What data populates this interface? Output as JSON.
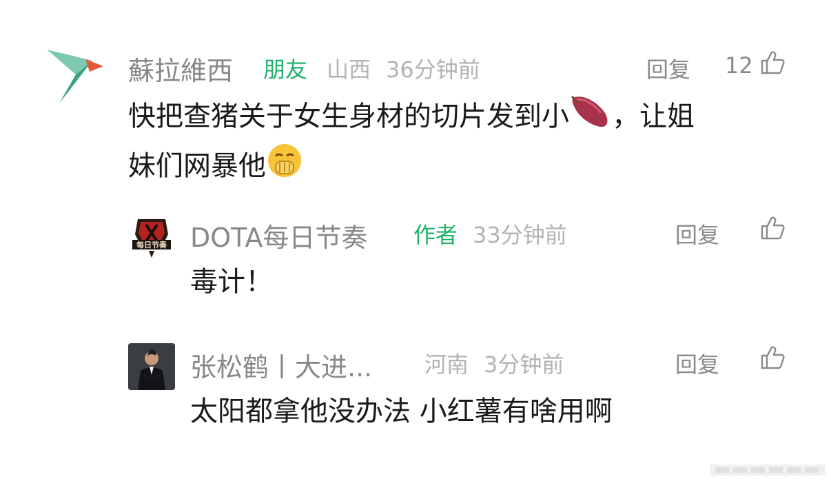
{
  "comments": [
    {
      "username": "蘇拉維西",
      "badge": "朋友",
      "location": "山西",
      "time": "36分钟前",
      "reply_label": "回复",
      "likes": "12",
      "content_line1_a": "快把查猪关于女生身材的切片发到小",
      "content_line1_b": "，让姐",
      "content_line2": "妹们网暴他",
      "inline_emoji_1": "sweet-potato-emoji",
      "inline_emoji_2": "fingers-together-smirk-emoji"
    }
  ],
  "replies": [
    {
      "username": "DOTA每日节奏",
      "badge": "作者",
      "time": "33分钟前",
      "reply_label": "回复",
      "content": "毒计！",
      "avatar_text": "每日节奏"
    },
    {
      "username": "张松鹤丨大进...",
      "location": "河南",
      "time": "3分钟前",
      "reply_label": "回复",
      "content": "太阳都拿他没办法 小红薯有啥用啊"
    }
  ],
  "colors": {
    "friend_tag": "#20b26b",
    "author_tag": "#20b26b",
    "meta": "#b3b3b3",
    "name": "#888888"
  }
}
